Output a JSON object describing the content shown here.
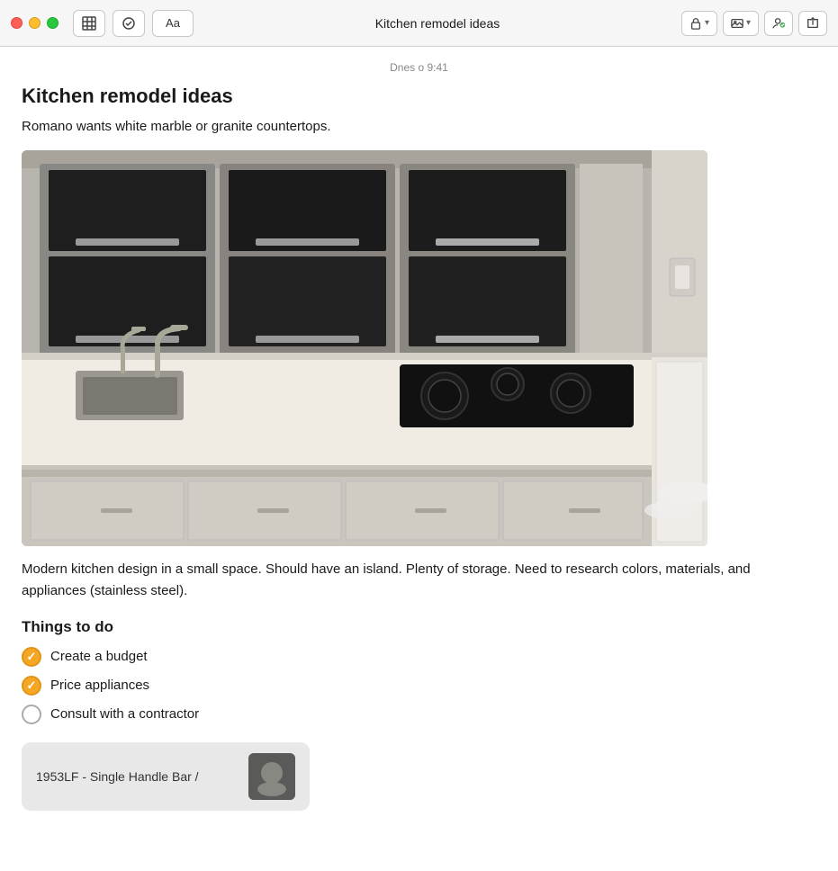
{
  "window": {
    "title": "Kitchen remodel ideas"
  },
  "titlebar": {
    "traffic": {
      "close_label": "",
      "minimize_label": "",
      "maximize_label": ""
    },
    "btn_table": "⊞",
    "btn_check": "⊙",
    "btn_font": "Aa",
    "lock_label": "🔒",
    "media_label": "🖼",
    "collab_label": "👤✓",
    "share_label": "↑"
  },
  "note": {
    "timestamp": "Dnes o 9:41",
    "title": "Kitchen remodel ideas",
    "subtitle": "Romano wants white marble or granite countertops.",
    "body_text": "Modern kitchen design in a small space. Should have an island. Plenty of storage. Need to research colors, materials, and appliances (stainless steel).",
    "section_title": "Things to do",
    "checklist": [
      {
        "id": 1,
        "label": "Create a budget",
        "checked": true
      },
      {
        "id": 2,
        "label": "Price appliances",
        "checked": true
      },
      {
        "id": 3,
        "label": "Consult with a contractor",
        "checked": false
      }
    ],
    "attachment": {
      "label": "1953LF - Single Handle Bar /"
    }
  }
}
